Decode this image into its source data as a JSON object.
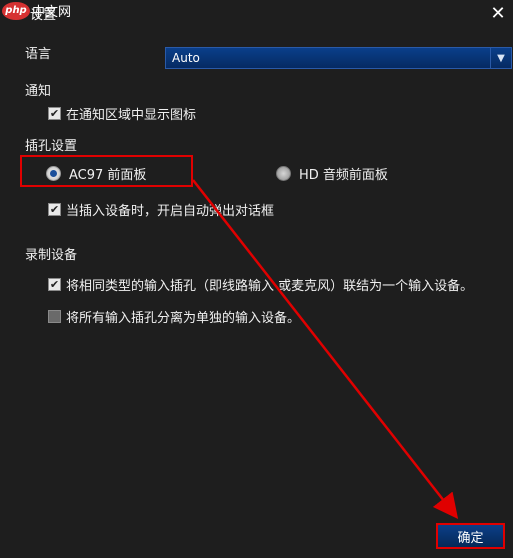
{
  "watermark": {
    "logo": "php",
    "text": "中文网"
  },
  "title": "设置",
  "language": {
    "label": "语言",
    "value": "Auto"
  },
  "notification": {
    "section": "通知",
    "show_icon": {
      "label": "在通知区域中显示图标",
      "checked": true
    }
  },
  "jack": {
    "section": "插孔设置",
    "options": [
      {
        "label": "AC97 前面板",
        "selected": true
      },
      {
        "label": "HD 音频前面板",
        "selected": false
      }
    ],
    "auto_popup": {
      "label": "当插入设备时，开启自动弹出对话框",
      "checked": true
    }
  },
  "recording": {
    "section": "录制设备",
    "combine": {
      "label": "将相同类型的输入插孔（即线路输入 或麦克风）联结为一个输入设备。",
      "checked": true
    },
    "separate": {
      "label": "将所有输入插孔分离为单独的输入设备。",
      "checked": false
    }
  },
  "buttons": {
    "ok": "确定",
    "close": "✕"
  },
  "icons": {
    "close": "close-icon",
    "dropdown": "chevron-down-icon",
    "check": "check-icon"
  },
  "colors": {
    "background": "#1e1e1e",
    "accent": "#0a3f8a",
    "annotation": "#e00000"
  }
}
